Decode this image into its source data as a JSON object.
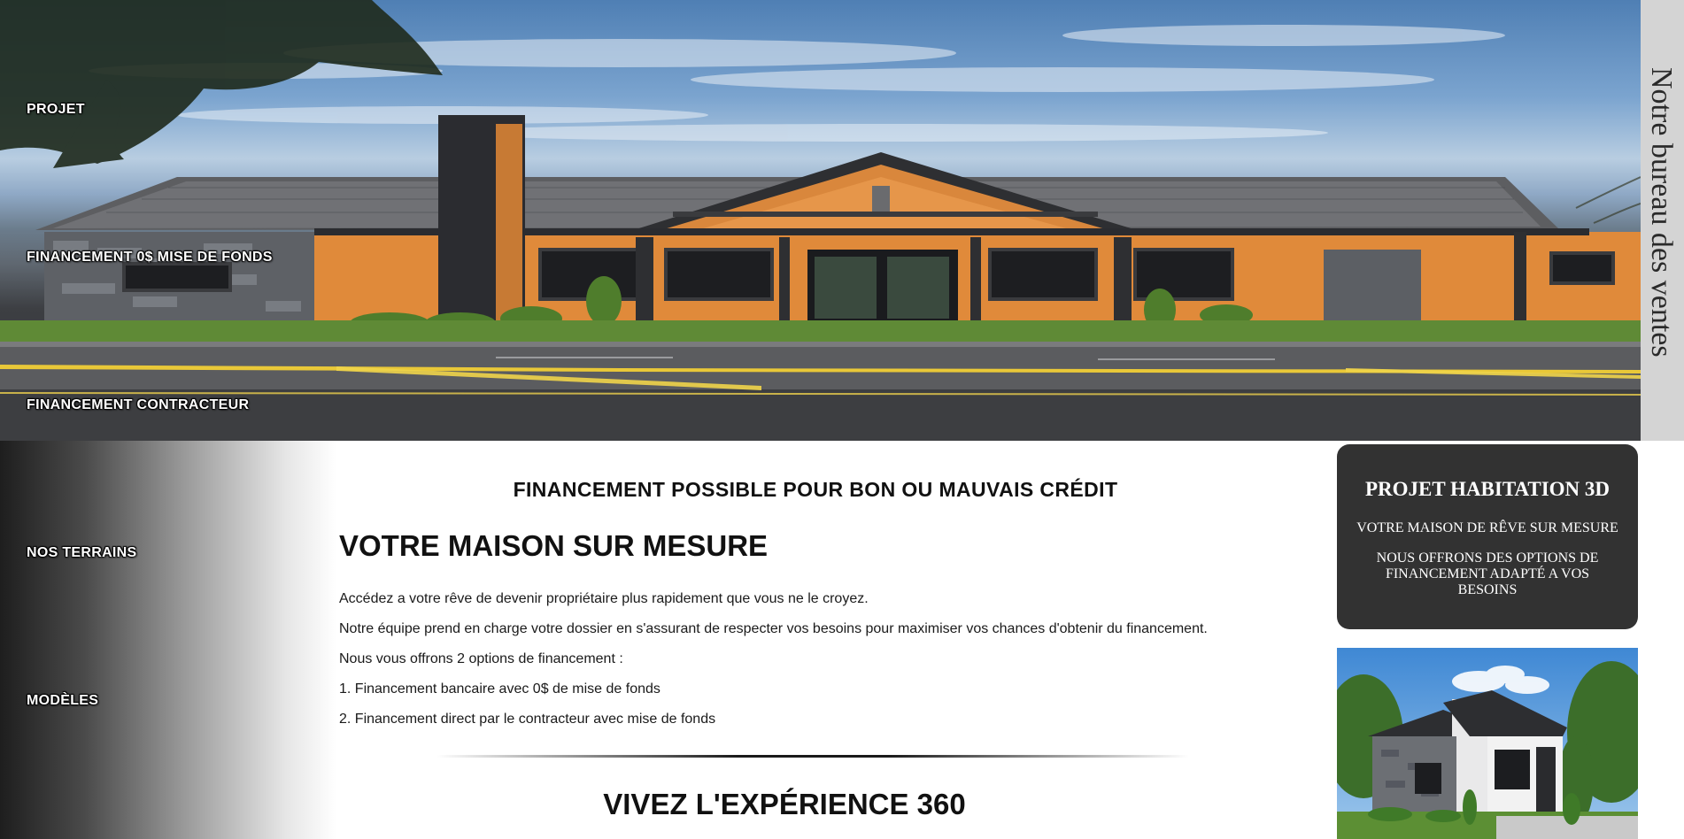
{
  "nav": {
    "items": [
      {
        "label": "PROJET"
      },
      {
        "label": "FINANCEMENT 0$ MISE DE FONDS"
      },
      {
        "label": "FINANCEMENT CONTRACTEUR"
      },
      {
        "label": "NOS TERRAINS"
      },
      {
        "label": "MODÈLES"
      }
    ]
  },
  "side_tab": {
    "label": "Notre bureau des ventes"
  },
  "main": {
    "tagline": "FINANCEMENT POSSIBLE POUR BON OU MAUVAIS CRÉDIT",
    "title": "VOTRE MAISON SUR MESURE",
    "paragraphs": [
      "Accédez a votre rêve de devenir propriétaire plus rapidement que vous ne le croyez.",
      "Notre équipe prend en charge votre dossier en s'assurant de respecter vos besoins pour maximiser vos chances d'obtenir du financement.",
      "Nous vous offrons 2 options de financement :",
      "1. Financement bancaire avec 0$ de mise de fonds",
      "2. Financement direct par le contracteur avec mise de fonds"
    ],
    "section_title": "VIVEZ L'EXPÉRIENCE 360"
  },
  "promo": {
    "title": "PROJET HABITATION 3D",
    "subtitle": "VOTRE MAISON DE RÊVE SUR MESURE",
    "text": "NOUS OFFRONS DES OPTIONS DE FINANCEMENT ADAPTÉ A VOS BESOINS"
  },
  "colors": {
    "card_bg": "#323232",
    "side_tab_bg": "#d4d4d4",
    "wood_siding": "#e08a3a",
    "text_dark": "#111111"
  }
}
